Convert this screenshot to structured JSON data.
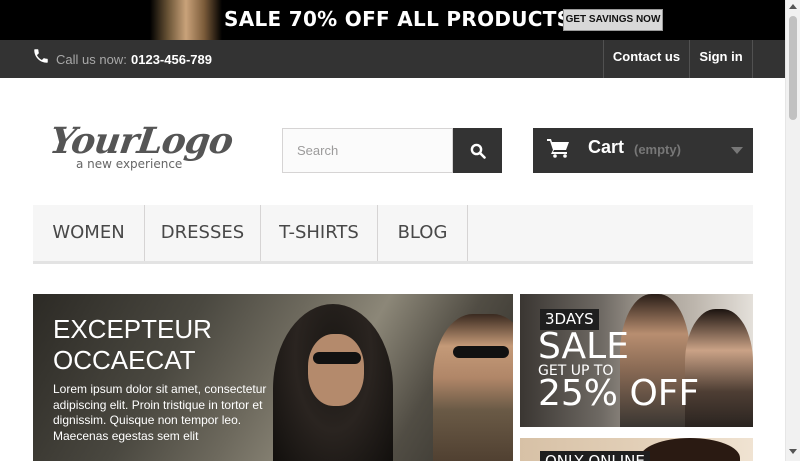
{
  "promo": {
    "text": "SALE 70% OFF ALL PRODUCTS",
    "button_label": "GET SAVINGS NOW"
  },
  "topbar": {
    "call_label": "Call us now:",
    "phone_number": "0123-456-789",
    "contact_label": "Contact us",
    "signin_label": "Sign in"
  },
  "header": {
    "logo_text": "YourLogo",
    "logo_tagline": "a new experience",
    "search_placeholder": "Search",
    "cart_label": "Cart",
    "cart_status": "(empty)"
  },
  "menu": {
    "items": [
      {
        "label": "WOMEN"
      },
      {
        "label": "DRESSES"
      },
      {
        "label": "T-SHIRTS"
      },
      {
        "label": "BLOG"
      }
    ]
  },
  "slider": {
    "title": "EXCEPTEUR OCCAECAT",
    "text": "Lorem ipsum dolor sit amet, consectetur adipiscing elit. Proin tristique in tortor et dignissim. Quisque non tempor leo. Maecenas egestas sem elit"
  },
  "banners": {
    "first": {
      "tag": "3DAYS",
      "headline": "SALE",
      "subline": "GET UP TO",
      "discount": "25% OFF"
    },
    "second": {
      "tag": "ONLY ONLINE"
    }
  },
  "colors": {
    "dark": "#333333",
    "promo_bg": "#000000",
    "menu_bg": "#f6f6f6",
    "menu_text": "#484848"
  },
  "icons": {
    "phone": "phone-icon",
    "search": "search-icon",
    "cart": "cart-icon",
    "caret": "caret-down-icon"
  }
}
